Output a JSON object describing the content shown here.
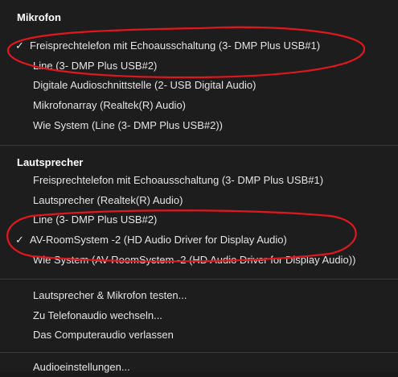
{
  "microphone": {
    "header": "Mikrofon",
    "items": [
      {
        "label": "Freisprechtelefon mit Echoausschaltung (3- DMP Plus USB#1)",
        "checked": true
      },
      {
        "label": "Line (3- DMP Plus USB#2)",
        "checked": false
      },
      {
        "label": "Digitale Audioschnittstelle (2- USB Digital Audio)",
        "checked": false
      },
      {
        "label": "Mikrofonarray (Realtek(R) Audio)",
        "checked": false
      },
      {
        "label": "Wie System (Line (3- DMP Plus USB#2))",
        "checked": false
      }
    ]
  },
  "speaker": {
    "header": "Lautsprecher",
    "items": [
      {
        "label": "Freisprechtelefon mit Echoausschaltung (3- DMP Plus USB#1)",
        "checked": false
      },
      {
        "label": "Lautsprecher (Realtek(R) Audio)",
        "checked": false
      },
      {
        "label": "Line (3- DMP Plus USB#2)",
        "checked": false
      },
      {
        "label": "AV-RoomSystem -2 (HD Audio Driver for Display Audio)",
        "checked": true
      },
      {
        "label": "Wie System (AV-RoomSystem -2 (HD Audio Driver for Display Audio))",
        "checked": false
      }
    ]
  },
  "actions": {
    "items": [
      {
        "label": "Lautsprecher & Mikrofon testen..."
      },
      {
        "label": "Zu Telefonaudio wechseln..."
      },
      {
        "label": "Das Computeraudio verlassen"
      }
    ]
  },
  "settings": {
    "items": [
      {
        "label": "Audioeinstellungen..."
      }
    ]
  },
  "check_glyph": "✓",
  "annotation_color": "#e0181e",
  "menu_background": "#1d1d1d"
}
